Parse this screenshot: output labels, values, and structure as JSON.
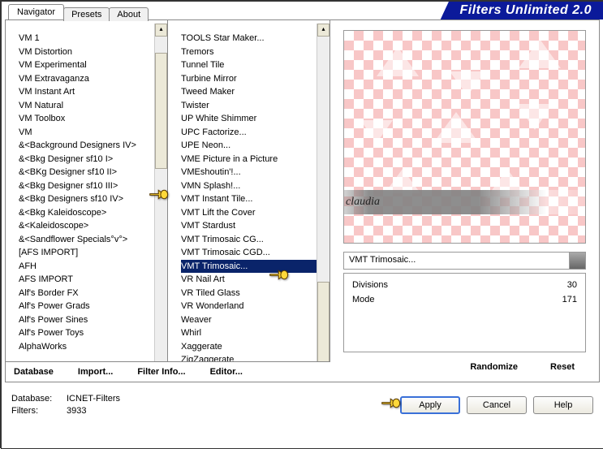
{
  "app_title": "Filters Unlimited 2.0",
  "tabs": {
    "navigator": "Navigator",
    "presets": "Presets",
    "about": "About"
  },
  "categories": [
    "VM 1",
    "VM Distortion",
    "VM Experimental",
    "VM Extravaganza",
    "VM Instant Art",
    "VM Natural",
    "VM Toolbox",
    "VM",
    "&<Background Designers IV>",
    "&<Bkg Designer sf10 I>",
    "&<BKg Designer sf10 II>",
    "&<Bkg Designer sf10 III>",
    "&<Bkg Designers sf10 IV>",
    "&<Bkg Kaleidoscope>",
    "&<Kaleidoscope>",
    "&<Sandflower Specials°v°>",
    "[AFS IMPORT]",
    "AFH",
    "AFS IMPORT",
    "Alf's Border FX",
    "Alf's Power Grads",
    "Alf's Power Sines",
    "Alf's Power Toys",
    "AlphaWorks"
  ],
  "filters": [
    "TOOLS Star Maker...",
    "Tremors",
    "Tunnel Tile",
    "Turbine Mirror",
    "Tweed Maker",
    "Twister",
    "UP White Shimmer",
    "UPC Factorize...",
    "UPE Neon...",
    "VME Picture in a Picture",
    "VMEshoutin'!...",
    "VMN Splash!...",
    "VMT Instant Tile...",
    "VMT Lift the Cover",
    "VMT Stardust",
    "VMT Trimosaic CG...",
    "VMT Trimosaic CGD...",
    "VMT Trimosaic...",
    "VR Nail Art",
    "VR Tiled Glass",
    "VR Wonderland",
    "Weaver",
    "Whirl",
    "Xaggerate",
    "ZigZaggerate"
  ],
  "selected_filter": "VMT Trimosaic...",
  "watermark": "claudia",
  "params": [
    {
      "label": "Divisions",
      "value": "30"
    },
    {
      "label": "Mode",
      "value": "171"
    }
  ],
  "bottom_buttons": {
    "database": "Database",
    "import": "Import...",
    "filter_info": "Filter Info...",
    "editor": "Editor..."
  },
  "right_buttons": {
    "randomize": "Randomize",
    "reset": "Reset"
  },
  "footer": {
    "db_label": "Database:",
    "db_value": "ICNET-Filters",
    "filters_label": "Filters:",
    "filters_value": "3933"
  },
  "actions": {
    "apply": "Apply",
    "cancel": "Cancel",
    "help": "Help"
  }
}
